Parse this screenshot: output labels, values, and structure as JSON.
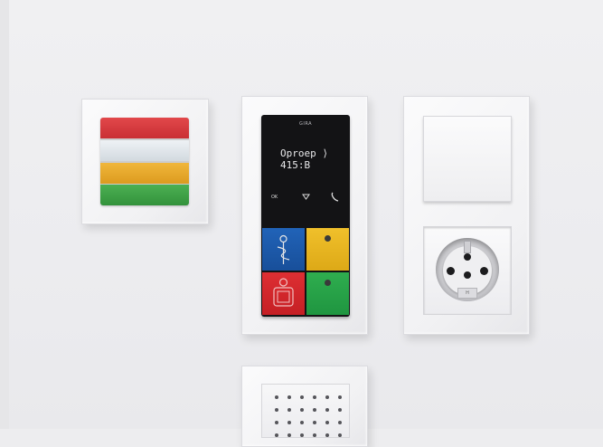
{
  "scene": {
    "background_color": "#ededef",
    "status_light": {
      "colors": [
        "#d9393d",
        "#dfe4ea",
        "#e7a82a",
        "#43a24b"
      ]
    },
    "intercom": {
      "brand": "GIRA",
      "display_lines": [
        "Oproep ⟩",
        "415:B"
      ],
      "nav_ok": "OK",
      "keys": [
        {
          "color": "#1d54a8",
          "icon": "person-caduceus-icon"
        },
        {
          "color": "#e9b821",
          "icon": "dot-icon"
        },
        {
          "color": "#d8262b",
          "icon": "door-icon"
        },
        {
          "color": "#27a548",
          "icon": "dot-icon"
        }
      ]
    },
    "socket": {
      "tab_label": "H"
    }
  }
}
